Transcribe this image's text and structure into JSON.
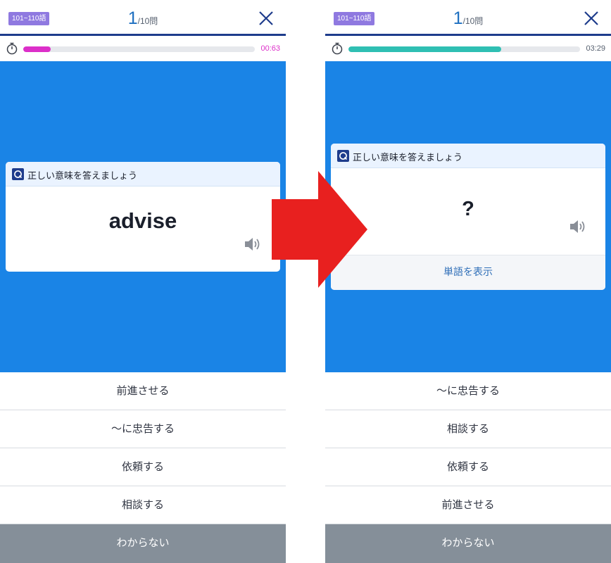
{
  "left_screen": {
    "range_badge": "101~110語",
    "counter_current": "1",
    "counter_total": "/10問",
    "timer_text": "00:63",
    "progress_fraction": 0.12,
    "card_instruction": "正しい意味を答えましょう",
    "word": "advise",
    "choices": [
      "前進させる",
      "～に忠告する",
      "依頼する",
      "相談する"
    ],
    "dont_know": "わからない"
  },
  "right_screen": {
    "range_badge": "101~110語",
    "counter_current": "1",
    "counter_total": "/10問",
    "timer_text": "03:29",
    "progress_fraction": 0.66,
    "card_instruction": "正しい意味を答えましょう",
    "hidden_word": "?",
    "reveal_label": "単語を表示",
    "choices": [
      "～に忠告する",
      "相談する",
      "依頼する",
      "前進させる"
    ],
    "dont_know": "わからない"
  },
  "colors": {
    "primary_blue": "#1a84e6",
    "header_rule": "#1e3c8c",
    "badge_purple": "#8f79e0",
    "timer_pink": "#dc2fc9",
    "timer_teal": "#2fbfb3",
    "arrow_red": "#e8201f",
    "dont_know_gray": "#858f99"
  },
  "icons": [
    "close-icon",
    "stopwatch-icon",
    "quiz-icon",
    "speaker-icon",
    "transition-arrow-icon"
  ]
}
